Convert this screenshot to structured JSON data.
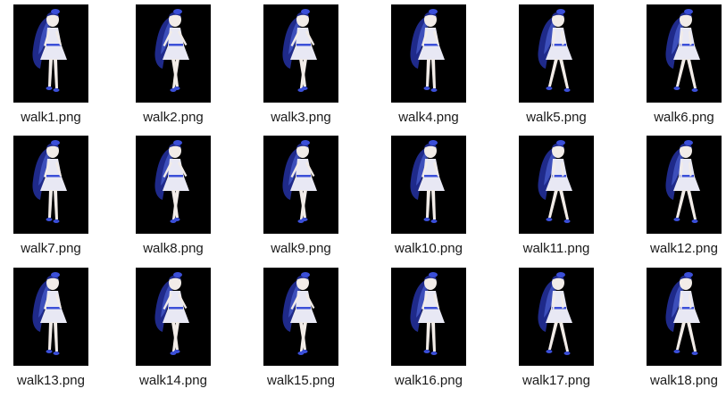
{
  "window": {
    "view": "large-icons",
    "thumbnail_background": "#000000",
    "figure_colors": {
      "hair": "#1f2a8a",
      "hair_highlight": "#4a5fd0",
      "dress": "#e8e8f4",
      "skin": "#f2ece8",
      "accent": "#3b4fd8"
    }
  },
  "files": [
    {
      "name": "walk1.png",
      "icon": "image-thumbnail-icon"
    },
    {
      "name": "walk2.png",
      "icon": "image-thumbnail-icon"
    },
    {
      "name": "walk3.png",
      "icon": "image-thumbnail-icon"
    },
    {
      "name": "walk4.png",
      "icon": "image-thumbnail-icon"
    },
    {
      "name": "walk5.png",
      "icon": "image-thumbnail-icon"
    },
    {
      "name": "walk6.png",
      "icon": "image-thumbnail-icon"
    },
    {
      "name": "walk7.png",
      "icon": "image-thumbnail-icon"
    },
    {
      "name": "walk8.png",
      "icon": "image-thumbnail-icon"
    },
    {
      "name": "walk9.png",
      "icon": "image-thumbnail-icon"
    },
    {
      "name": "walk10.png",
      "icon": "image-thumbnail-icon"
    },
    {
      "name": "walk11.png",
      "icon": "image-thumbnail-icon"
    },
    {
      "name": "walk12.png",
      "icon": "image-thumbnail-icon"
    },
    {
      "name": "walk13.png",
      "icon": "image-thumbnail-icon"
    },
    {
      "name": "walk14.png",
      "icon": "image-thumbnail-icon"
    },
    {
      "name": "walk15.png",
      "icon": "image-thumbnail-icon"
    },
    {
      "name": "walk16.png",
      "icon": "image-thumbnail-icon"
    },
    {
      "name": "walk17.png",
      "icon": "image-thumbnail-icon"
    },
    {
      "name": "walk18.png",
      "icon": "image-thumbnail-icon"
    }
  ]
}
